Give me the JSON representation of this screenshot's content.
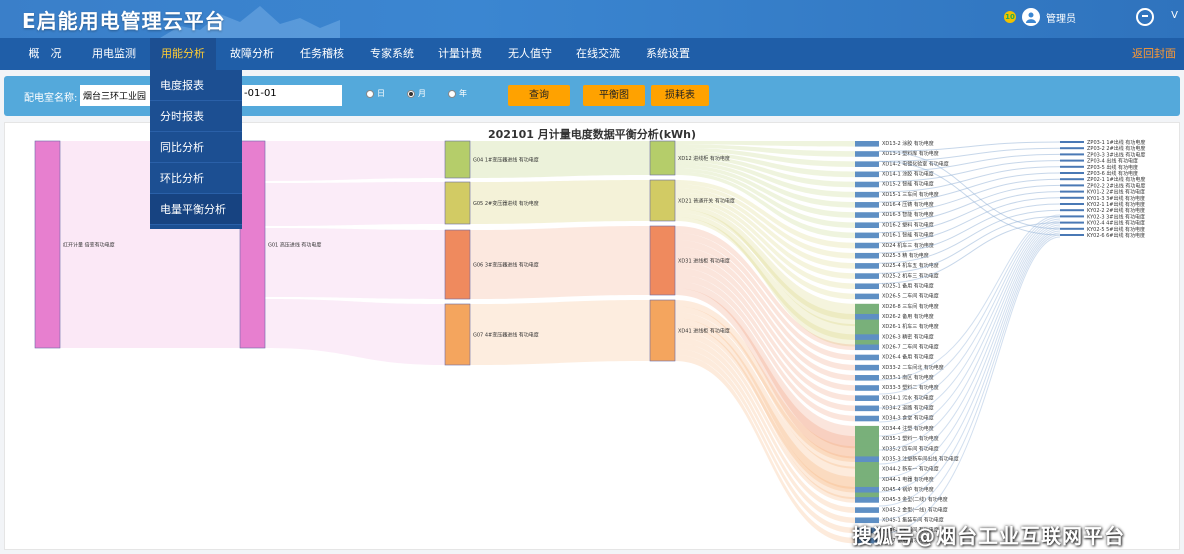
{
  "header": {
    "title": "E启能用电管理云平台",
    "badge": "10",
    "user": "管理员",
    "version": "V"
  },
  "nav": {
    "items": [
      {
        "label": "概　况"
      },
      {
        "label": "用电监测"
      },
      {
        "label": "用能分析"
      },
      {
        "label": "故障分析"
      },
      {
        "label": "任务稽核"
      },
      {
        "label": "专家系统"
      },
      {
        "label": "计量计费"
      },
      {
        "label": "无人值守"
      },
      {
        "label": "在线交流"
      },
      {
        "label": "系统设置"
      }
    ],
    "back": "返回封面",
    "active_index": 2
  },
  "dropdown": {
    "items": [
      {
        "label": "电度报表"
      },
      {
        "label": "分时报表"
      },
      {
        "label": "同比分析"
      },
      {
        "label": "环比分析"
      },
      {
        "label": "电量平衡分析"
      }
    ],
    "active_index": 4
  },
  "filter": {
    "label": "配电室名称:",
    "room_value": "烟台三环工业园",
    "date_value": "-01-01",
    "radios": [
      {
        "label": "日",
        "checked": false
      },
      {
        "label": "月",
        "checked": true
      },
      {
        "label": "年",
        "checked": false
      }
    ],
    "buttons": {
      "query": "查询",
      "balance": "平衡图",
      "loss": "损耗表"
    }
  },
  "chart_data": {
    "type": "sankey",
    "title": "202101 月计量电度数据平衡分析(kWh)",
    "nodes": [
      {
        "label": "红开计量 倍变有功电度",
        "color": "#e77fcf"
      },
      {
        "label": "G01 高压进线 有功电度",
        "color": "#e77fcf"
      },
      {
        "label": "G04 1#变压器进线 有功电度",
        "color": "#b5cd6a"
      },
      {
        "label": "G05 2#变压器进线 有功电度",
        "color": "#d2cb64"
      },
      {
        "label": "G06 3#变压器进线 有功电度",
        "color": "#ef8a5e"
      },
      {
        "label": "G07 4#变压器进线 有功电度",
        "color": "#f4a55e"
      },
      {
        "label": "XD12 进线柜 有功电度",
        "color": "#b5cd6a"
      },
      {
        "label": "XD21 普通开关 有功电度",
        "color": "#d2cb64"
      },
      {
        "label": "XD31 进线柜 有功电度",
        "color": "#ef8a5e"
      },
      {
        "label": "XD41 进线柜 有功电度",
        "color": "#f4a55e"
      }
    ],
    "column4_labels": [
      "XD13-2 涂胶 有功电度",
      "XD13-1 塑料库 有功电度",
      "XD14-2 电镀化验室 有功电度",
      "XD14-1 涂胶 有功电度",
      "XD15-2 智能 有功电度",
      "XD15-1 三车间 有功电度",
      "XD16-4 压铸 有功电度",
      "XD16-3 智能 有功电度",
      "XD16-2 塑料 有功电度",
      "XD16-1 智能 有功电度",
      "XD24 机车三 有功电度",
      "XD25-3 精 有功电度",
      "XD25-4 机车五 有功电度",
      "XD25-2 机车三 有功电度",
      "XD25-1 备用 有功电度",
      "XD26-5 二车间 有功电度",
      "XD26-8 三车间 有功电度",
      "XD26-2 备用 有功电度",
      "XD26-1 机车三 有功电度",
      "XD26-3 精密 有功电度",
      "XD26-7 二车间 有功电度",
      "XD26-4 备用 有功电度",
      "XD33-2 二车间北 有功电度",
      "XD33-1 南区 有功电度",
      "XD33-3 塑料二 有功电度",
      "XD34-1 污水 有功电度",
      "XD34-2 道路 有功电度",
      "XD34-3 食堂 有功电度",
      "XD34-4 注塑 有功电度",
      "XD35-1 塑料一 有功电度",
      "XD35-2 四车间 有功电度",
      "XD35-3 注塑新车间出线 有功电度",
      "XD44-2 新车一 有功电度",
      "XD44-1 电器 有功电度",
      "XD45-4 锅炉 有功电度",
      "XD45-3 金型(二线) 有功电度",
      "XD45-2 金型(一线) 有功电度",
      "XD45-1 集装车间 有功电度",
      "XD46-2 五车间 有功电度",
      "XD47 备用 有功电度"
    ],
    "column5_labels": [
      "ZP03-1 1#出线 有功电度",
      "ZP03-2 2#出线 有功电度",
      "ZP03-3 3#出线 有功电度",
      "ZP03-4 出线 有功电度",
      "ZP03-5 出线 有功电度",
      "ZP03-6 出线 有功电度",
      "ZP02-1 1#出线 有功电度",
      "ZP02-2 2#出线 有功电度",
      "KY01-2 2#出线 有功电度",
      "KY01-3 3#出线 有功电度",
      "KY02-1 1#出线 有功电度",
      "KY02-2 2#出线 有功电度",
      "KY02-3 3#出线 有功电度",
      "KY02-4 4#出线 有功电度",
      "KY02-5 5#出线 有功电度",
      "KY02-6 6#出线 有功电度"
    ]
  },
  "watermark": "搜狐号@烟台工业互联网平台"
}
